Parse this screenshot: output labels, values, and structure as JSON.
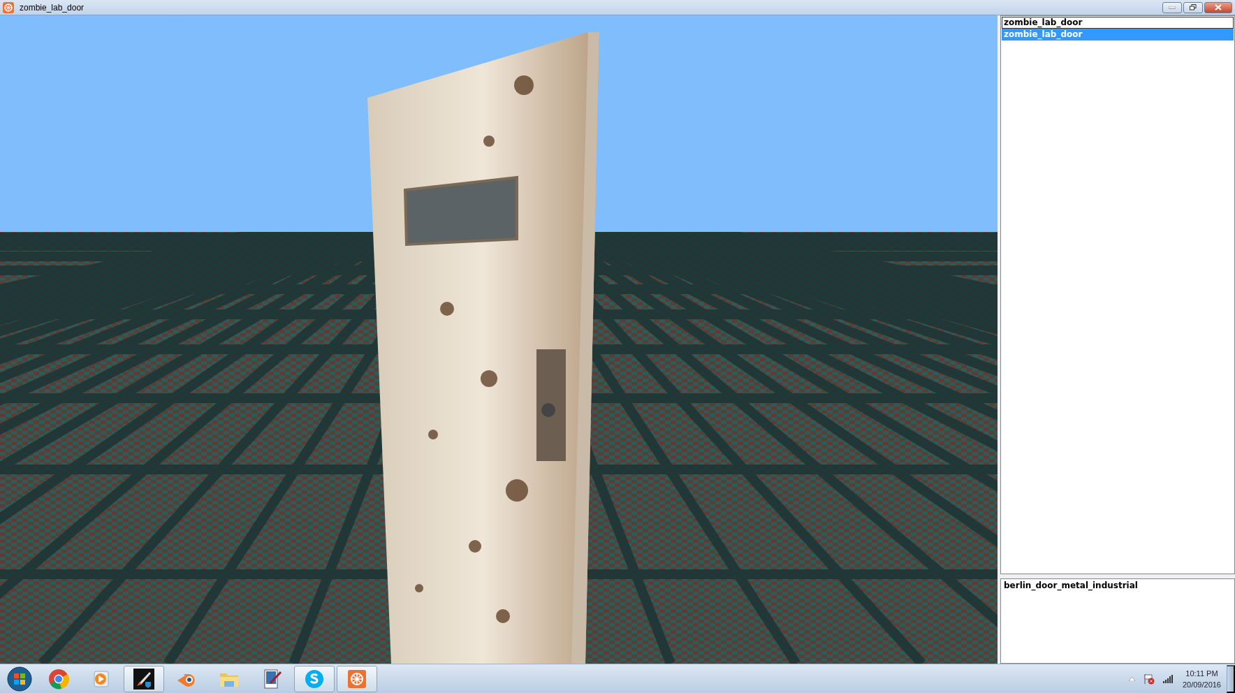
{
  "window": {
    "title": "zombie_lab_door"
  },
  "object_list": {
    "items": [
      {
        "label": "zombie_lab_door",
        "selected": false
      },
      {
        "label": "zombie_lab_door",
        "selected": true
      }
    ]
  },
  "texture_list": {
    "items": [
      {
        "label": "berlin_door_metal_industrial"
      }
    ]
  },
  "taskbar": {
    "apps": [
      {
        "kind": "chrome",
        "open": false
      },
      {
        "kind": "player",
        "open": false
      },
      {
        "kind": "rocket",
        "open": true
      },
      {
        "kind": "blender",
        "open": false
      },
      {
        "kind": "folder",
        "open": false
      },
      {
        "kind": "paint",
        "open": false
      },
      {
        "kind": "skype",
        "open": true
      },
      {
        "kind": "orange",
        "open": true
      }
    ],
    "time": "10:11 PM",
    "date": "20/09/2016"
  }
}
